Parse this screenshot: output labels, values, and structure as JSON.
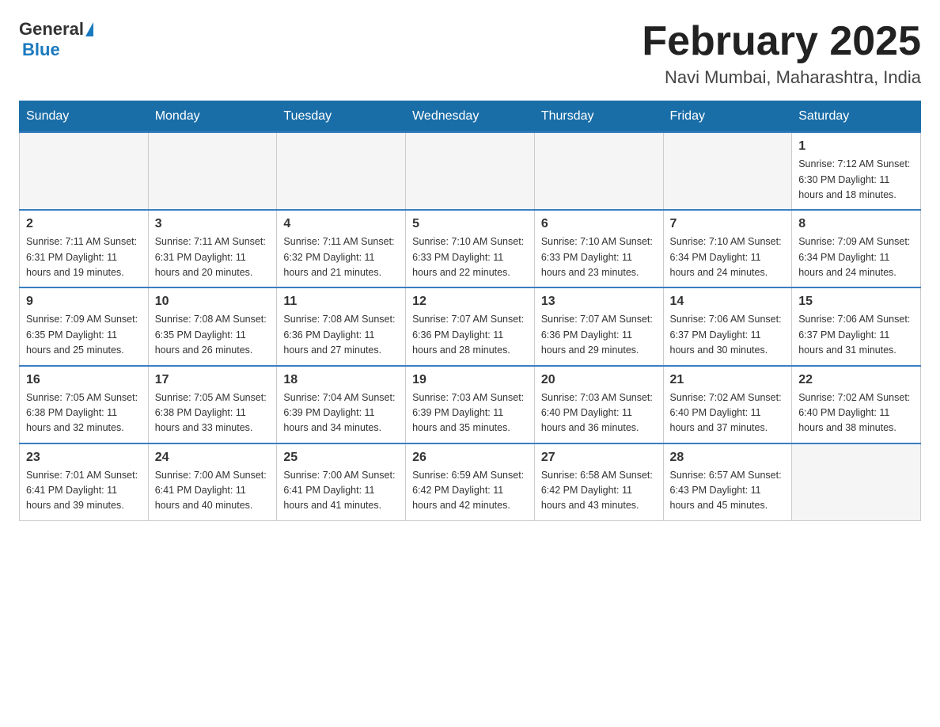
{
  "logo": {
    "general": "General",
    "blue": "Blue"
  },
  "header": {
    "title": "February 2025",
    "subtitle": "Navi Mumbai, Maharashtra, India"
  },
  "weekdays": [
    "Sunday",
    "Monday",
    "Tuesday",
    "Wednesday",
    "Thursday",
    "Friday",
    "Saturday"
  ],
  "weeks": [
    [
      {
        "day": "",
        "info": ""
      },
      {
        "day": "",
        "info": ""
      },
      {
        "day": "",
        "info": ""
      },
      {
        "day": "",
        "info": ""
      },
      {
        "day": "",
        "info": ""
      },
      {
        "day": "",
        "info": ""
      },
      {
        "day": "1",
        "info": "Sunrise: 7:12 AM\nSunset: 6:30 PM\nDaylight: 11 hours and 18 minutes."
      }
    ],
    [
      {
        "day": "2",
        "info": "Sunrise: 7:11 AM\nSunset: 6:31 PM\nDaylight: 11 hours and 19 minutes."
      },
      {
        "day": "3",
        "info": "Sunrise: 7:11 AM\nSunset: 6:31 PM\nDaylight: 11 hours and 20 minutes."
      },
      {
        "day": "4",
        "info": "Sunrise: 7:11 AM\nSunset: 6:32 PM\nDaylight: 11 hours and 21 minutes."
      },
      {
        "day": "5",
        "info": "Sunrise: 7:10 AM\nSunset: 6:33 PM\nDaylight: 11 hours and 22 minutes."
      },
      {
        "day": "6",
        "info": "Sunrise: 7:10 AM\nSunset: 6:33 PM\nDaylight: 11 hours and 23 minutes."
      },
      {
        "day": "7",
        "info": "Sunrise: 7:10 AM\nSunset: 6:34 PM\nDaylight: 11 hours and 24 minutes."
      },
      {
        "day": "8",
        "info": "Sunrise: 7:09 AM\nSunset: 6:34 PM\nDaylight: 11 hours and 24 minutes."
      }
    ],
    [
      {
        "day": "9",
        "info": "Sunrise: 7:09 AM\nSunset: 6:35 PM\nDaylight: 11 hours and 25 minutes."
      },
      {
        "day": "10",
        "info": "Sunrise: 7:08 AM\nSunset: 6:35 PM\nDaylight: 11 hours and 26 minutes."
      },
      {
        "day": "11",
        "info": "Sunrise: 7:08 AM\nSunset: 6:36 PM\nDaylight: 11 hours and 27 minutes."
      },
      {
        "day": "12",
        "info": "Sunrise: 7:07 AM\nSunset: 6:36 PM\nDaylight: 11 hours and 28 minutes."
      },
      {
        "day": "13",
        "info": "Sunrise: 7:07 AM\nSunset: 6:36 PM\nDaylight: 11 hours and 29 minutes."
      },
      {
        "day": "14",
        "info": "Sunrise: 7:06 AM\nSunset: 6:37 PM\nDaylight: 11 hours and 30 minutes."
      },
      {
        "day": "15",
        "info": "Sunrise: 7:06 AM\nSunset: 6:37 PM\nDaylight: 11 hours and 31 minutes."
      }
    ],
    [
      {
        "day": "16",
        "info": "Sunrise: 7:05 AM\nSunset: 6:38 PM\nDaylight: 11 hours and 32 minutes."
      },
      {
        "day": "17",
        "info": "Sunrise: 7:05 AM\nSunset: 6:38 PM\nDaylight: 11 hours and 33 minutes."
      },
      {
        "day": "18",
        "info": "Sunrise: 7:04 AM\nSunset: 6:39 PM\nDaylight: 11 hours and 34 minutes."
      },
      {
        "day": "19",
        "info": "Sunrise: 7:03 AM\nSunset: 6:39 PM\nDaylight: 11 hours and 35 minutes."
      },
      {
        "day": "20",
        "info": "Sunrise: 7:03 AM\nSunset: 6:40 PM\nDaylight: 11 hours and 36 minutes."
      },
      {
        "day": "21",
        "info": "Sunrise: 7:02 AM\nSunset: 6:40 PM\nDaylight: 11 hours and 37 minutes."
      },
      {
        "day": "22",
        "info": "Sunrise: 7:02 AM\nSunset: 6:40 PM\nDaylight: 11 hours and 38 minutes."
      }
    ],
    [
      {
        "day": "23",
        "info": "Sunrise: 7:01 AM\nSunset: 6:41 PM\nDaylight: 11 hours and 39 minutes."
      },
      {
        "day": "24",
        "info": "Sunrise: 7:00 AM\nSunset: 6:41 PM\nDaylight: 11 hours and 40 minutes."
      },
      {
        "day": "25",
        "info": "Sunrise: 7:00 AM\nSunset: 6:41 PM\nDaylight: 11 hours and 41 minutes."
      },
      {
        "day": "26",
        "info": "Sunrise: 6:59 AM\nSunset: 6:42 PM\nDaylight: 11 hours and 42 minutes."
      },
      {
        "day": "27",
        "info": "Sunrise: 6:58 AM\nSunset: 6:42 PM\nDaylight: 11 hours and 43 minutes."
      },
      {
        "day": "28",
        "info": "Sunrise: 6:57 AM\nSunset: 6:43 PM\nDaylight: 11 hours and 45 minutes."
      },
      {
        "day": "",
        "info": ""
      }
    ]
  ]
}
